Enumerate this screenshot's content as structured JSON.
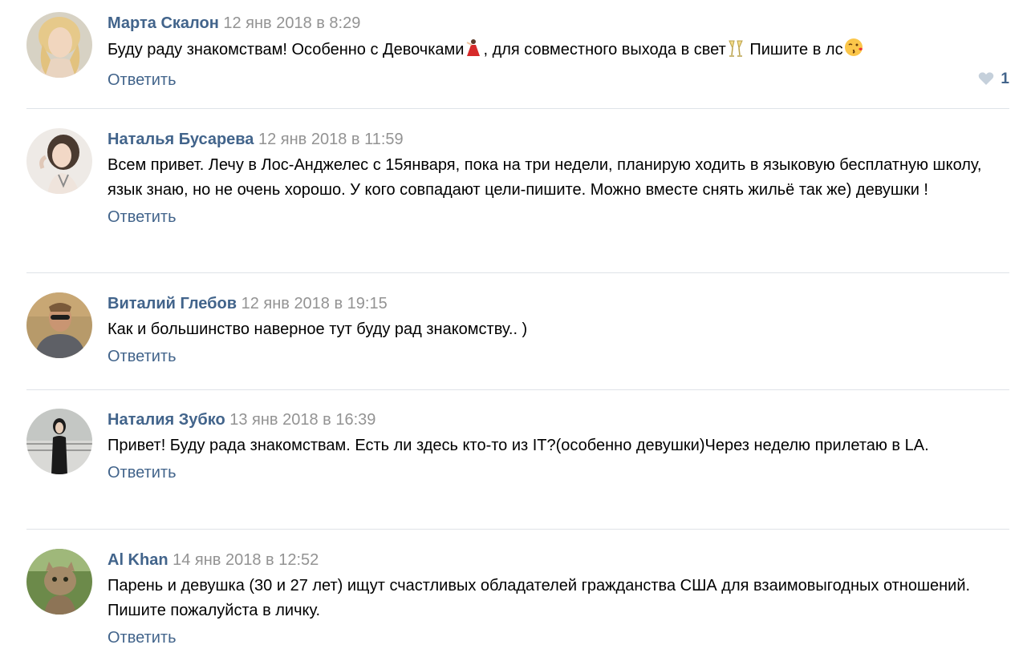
{
  "colors": {
    "author": "#42648b",
    "date": "#939393",
    "reply": "#42648b",
    "divider": "#dfe3e8",
    "like_heart": "#c5d0db"
  },
  "comments": [
    {
      "author": "Марта Скалон",
      "date": "12 янв 2018 в 8:29",
      "text_parts": [
        "Буду раду знакомствам! Особенно с Девочками",
        ", для совместного выхода в свет",
        " Пишите в лс"
      ],
      "emojis": [
        "dancer-emoji",
        "champagne-emoji",
        "kiss-face-emoji"
      ],
      "reply": "Ответить",
      "likes": "1",
      "like_icon": "heart-icon"
    },
    {
      "author": "Наталья Бусарева",
      "date": "12 янв 2018 в 11:59",
      "text": "Всем привет. Лечу в Лос-Анджелес с 15января, пока на три недели, планирую ходить в языковую бесплатную школу, язык знаю, но не очень хорошо. У кого совпадают цели-пишите. Можно вместе снять жильё так же) девушки !",
      "reply": "Ответить"
    },
    {
      "author": "Виталий Глебов",
      "date": "12 янв 2018 в 19:15",
      "text": "Как и большинство наверное тут буду рад знакомству.. )",
      "reply": "Ответить"
    },
    {
      "author": "Наталия Зубко",
      "date": "13 янв 2018 в 16:39",
      "text": "Привет! Буду рада знакомствам. Есть ли здесь кто-то из IT?(особенно девушки)Через неделю прилетаю в LA.",
      "reply": "Ответить"
    },
    {
      "author": "Al Khan",
      "date": "14 янв 2018 в 12:52",
      "text": "Парень и девушка (30 и 27 лет) ищут счастливых обладателей гражданства США для взаимовыгодных отношений. Пишите пожалуйста в личку.",
      "reply": "Ответить"
    }
  ]
}
